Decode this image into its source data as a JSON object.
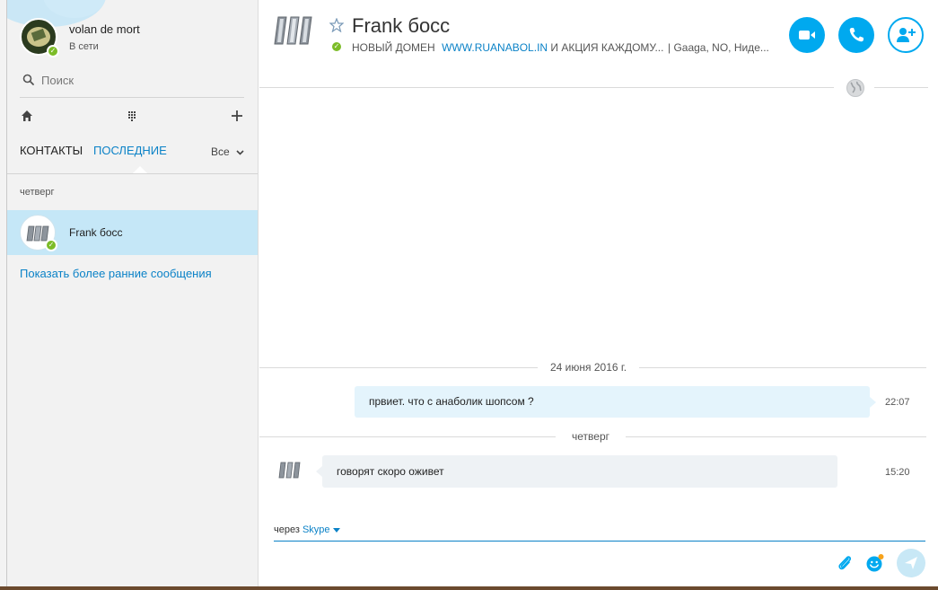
{
  "colors": {
    "accent": "#00a9ef",
    "link": "#0b82c7",
    "online": "#7cbc28",
    "selected_row": "#c5e7f7",
    "outgoing_bubble": "#e4f4fc",
    "incoming_bubble": "#eef2f5"
  },
  "profile": {
    "name": "volan de mort",
    "status": "В сети"
  },
  "search": {
    "placeholder": "Поиск"
  },
  "toolbar": {
    "icons": [
      "home-icon",
      "dialpad-icon",
      "plus-icon"
    ]
  },
  "tabs": {
    "contacts": "КОНТАКТЫ",
    "recent": "ПОСЛЕДНИЕ",
    "filter": "Все"
  },
  "recent": {
    "group_label": "четверг",
    "items": [
      {
        "name": "Frank босс"
      }
    ],
    "show_earlier": "Показать более ранние сообщения"
  },
  "conversation": {
    "name": "Frank босс",
    "mood_prefix": "НОВЫЙ ДОМЕН",
    "mood_link": "WWW.RUANABOL.IN",
    "mood_suffix": "И АКЦИЯ КАЖДОМУ...",
    "location": "|  Gaaga, NO, Ниде..."
  },
  "messages": {
    "date_separator": "24 июня 2016 г.",
    "outgoing": {
      "text": "првиет. что с анаболик шопсом ?",
      "time": "22:07"
    },
    "day_separator": "четверг",
    "incoming": {
      "text": "говорят скоро оживет",
      "time": "15:20"
    }
  },
  "composer": {
    "via_prefix": "через",
    "via_service": "Skype"
  }
}
